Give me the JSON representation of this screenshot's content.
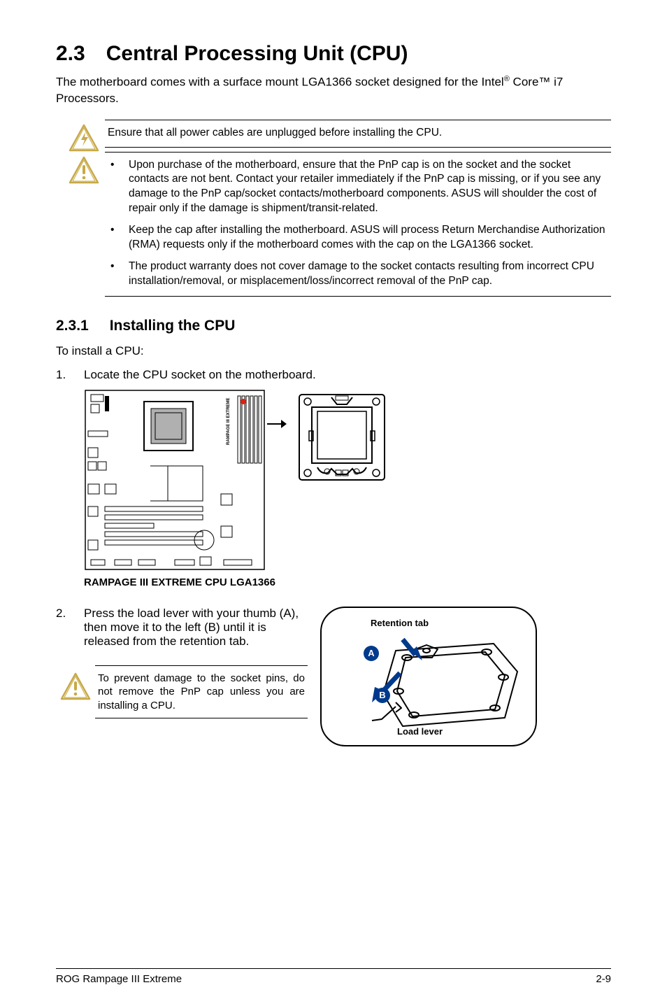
{
  "section": {
    "number": "2.3",
    "title": "Central Processing Unit (CPU)"
  },
  "intro": "The motherboard comes with a surface mount LGA1366 socket designed for the Intel® Core™ i7 Processors.",
  "zap_notice": "Ensure that all power cables are unplugged before installing the CPU.",
  "warn_bullets": [
    "Upon purchase of the motherboard, ensure that the PnP cap is on the socket and the socket contacts are not bent. Contact your retailer immediately if the PnP cap is missing, or if you see any damage to the PnP cap/socket contacts/motherboard components. ASUS will shoulder the cost of repair only if the damage is shipment/transit-related.",
    "Keep the cap after installing the motherboard. ASUS will process Return Merchandise Authorization (RMA) requests only if the motherboard comes with the cap on the LGA1366 socket.",
    "The product warranty does not cover damage to the socket contacts resulting from incorrect CPU installation/removal, or misplacement/loss/incorrect removal of the PnP cap."
  ],
  "subsection": {
    "number": "2.3.1",
    "title": "Installing the CPU"
  },
  "lead_in": "To install a CPU:",
  "steps": {
    "s1_num": "1.",
    "s1_text": "Locate the CPU socket on the motherboard.",
    "s2_num": "2.",
    "s2_text": "Press the load lever with your thumb (A), then move it to the left (B) until it is released from the retention tab."
  },
  "diagram_caption": "RAMPAGE III EXTREME CPU LGA1366",
  "pnp_warning": "To prevent damage to the socket pins, do not remove the PnP cap unless you are installing a CPU.",
  "callout": {
    "retention": "Retention tab",
    "load_lever": "Load lever",
    "badge_a": "A",
    "badge_b": "B"
  },
  "footer": {
    "left": "ROG Rampage III Extreme",
    "right": "2-9"
  }
}
